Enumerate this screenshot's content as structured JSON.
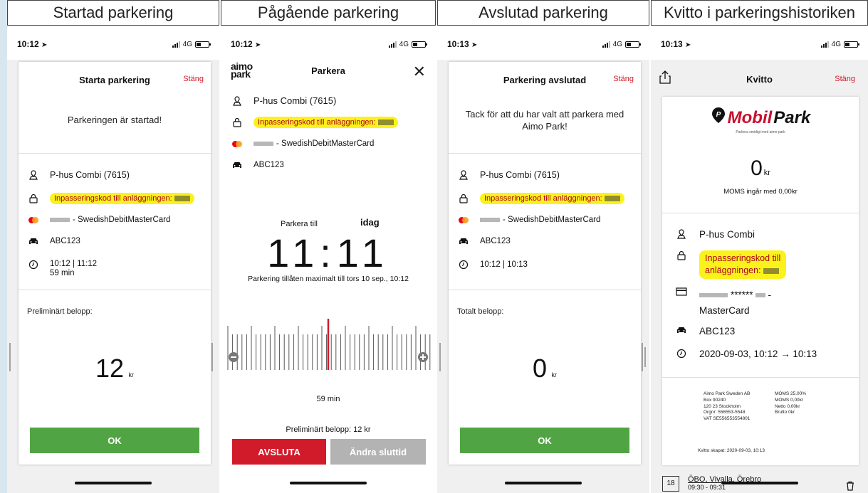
{
  "headers": [
    "Startad parkering",
    "Pågående parkering",
    "Avslutad parkering",
    "Kvitto i parkeringshistoriken"
  ],
  "status": {
    "col1_time": "10:12",
    "col2_time": "10:12",
    "col3_time": "10:13",
    "col4_time": "10:13",
    "network": "4G"
  },
  "icons": {
    "location": "location-arrow-icon",
    "signal": "signal-bars-icon",
    "battery": "battery-icon",
    "place": "map-pin-person-icon",
    "lock": "padlock-icon",
    "card": "mastercard-icon",
    "car": "car-icon",
    "clock": "clock-icon",
    "share": "share-icon",
    "close": "close-x-icon",
    "minus": "minus-circle-icon",
    "plus": "plus-circle-icon",
    "credit_card": "credit-card-icon",
    "trash": "trash-icon"
  },
  "colors": {
    "accent_red": "#d11a2a",
    "ok_green": "#51a443",
    "highlight_yellow": "#fbf21c",
    "disabled_gray": "#b3b3b3"
  },
  "start": {
    "title": "Starta parkering",
    "close": "Stäng",
    "message": "Parkeringen är startad!",
    "place": "P-hus Combi (7615)",
    "code_label": "Inpasseringskod till anläggningen:",
    "card": "- SwedishDebitMasterCard",
    "plate": "ABC123",
    "time_range": "10:12 | 11:12",
    "duration": "59 min",
    "amount_label": "Preliminärt belopp:",
    "amount": "12",
    "unit": "kr",
    "ok": "OK"
  },
  "ongoing": {
    "logo_line1": "aimo",
    "logo_line2": "park",
    "title": "Parkera",
    "place": "P-hus Combi (7615)",
    "code_label": "Inpasseringskod till anläggningen:",
    "card": "- SwedishDebitMasterCard",
    "plate": "ABC123",
    "park_until": "Parkera till",
    "day": "idag",
    "time": "11:11",
    "max_note": "Parkering tillåten maximalt till tors 10 sep., 10:12",
    "duration": "59 min",
    "prelim": "Preliminärt belopp:  12 kr",
    "end_btn": "AVSLUTA",
    "change_btn": "Ändra sluttid"
  },
  "finished": {
    "title": "Parkering avslutad",
    "close": "Stäng",
    "message": "Tack för att du har valt att parkera med Aimo Park!",
    "place": "P-hus Combi (7615)",
    "code_label": "Inpasseringskod till anläggningen:",
    "card": "- SwedishDebitMasterCard",
    "plate": "ABC123",
    "time_range": "10:12 | 10:13",
    "amount_label": "Totalt belopp:",
    "amount": "0",
    "unit": "kr",
    "ok": "OK"
  },
  "receipt": {
    "title": "Kvitto",
    "close": "Stäng",
    "brand_mobil": "Mobil",
    "brand_park": "Park",
    "tagline": "Parkera smidigt med aimo park",
    "amount": "0",
    "unit": "kr",
    "vat_line": "MOMS ingår med 0,00kr",
    "place": "P-hus Combi",
    "code_line1": "Inpasseringskod till",
    "code_line2": "anläggningen:",
    "card_stars": "******",
    "card_dash": "-",
    "card_name": "MasterCard",
    "plate": "ABC123",
    "date_range": "2020-09-03, 10:12 → 10:13",
    "company": [
      "Aimo Park Sweden AB",
      "Box 90240",
      "120 23 Stockholm",
      "Orgnr: 556553-5548",
      "VAT SE556553554801"
    ],
    "vat_table": [
      "MOMS 25.00%",
      "MOMS 0,00kr",
      "Netto 0,00kr",
      "Brutto 0kr"
    ],
    "created": "Kvitto skapat: 2020-09-03, 10:13",
    "history_day": "18",
    "history_place": "ÖBO, Vivalla, Örebro",
    "history_sub": "09:30 - 09:31"
  }
}
